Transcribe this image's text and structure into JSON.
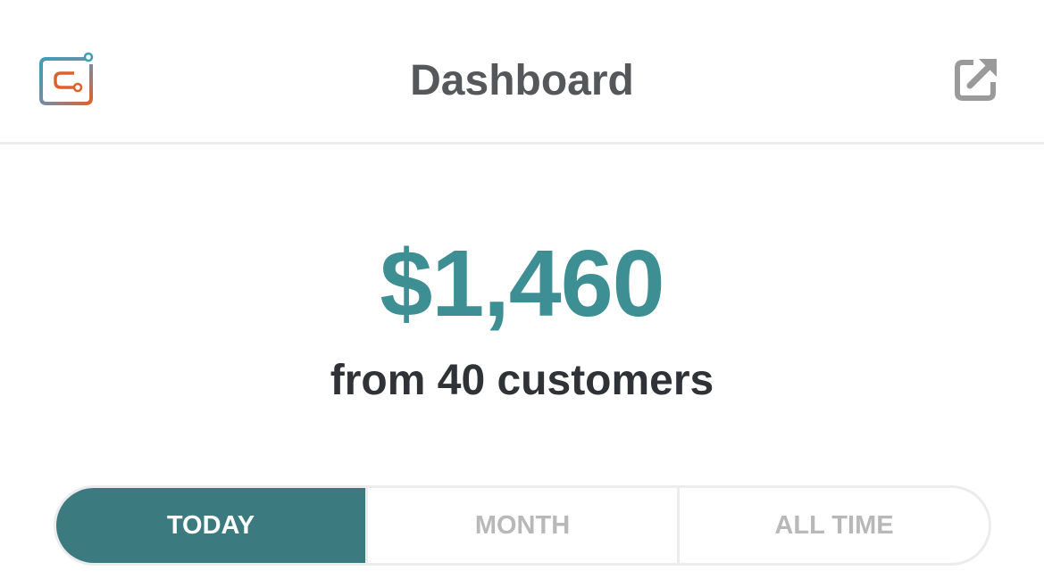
{
  "header": {
    "title": "Dashboard",
    "logo_icon": "app-logo-icon",
    "action_icon": "external-link-icon"
  },
  "summary": {
    "amount": "$1,460",
    "subtitle": "from 40 customers"
  },
  "period_tabs": [
    {
      "label": "TODAY",
      "selected": true
    },
    {
      "label": "MONTH",
      "selected": false
    },
    {
      "label": "ALL TIME",
      "selected": false
    }
  ],
  "colors": {
    "accent": "#3d8f94",
    "active_tab": "#3b7b80",
    "title_text": "#55575b",
    "body_text": "#2f3236",
    "inactive_tab_text": "#b8b8b8",
    "border": "#ececec"
  }
}
